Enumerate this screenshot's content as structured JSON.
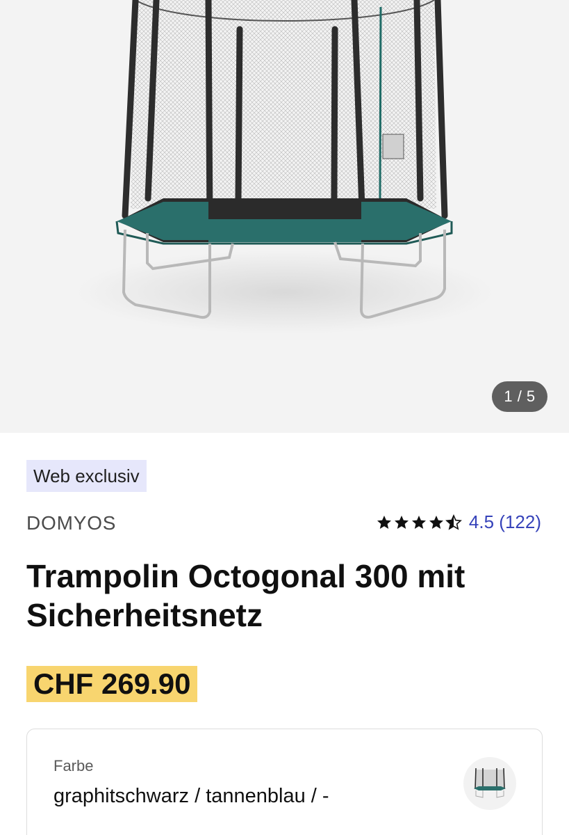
{
  "gallery": {
    "image_alt": "Trampolin Octogonal 300 mit Sicherheitsnetz",
    "counter": "1 / 5"
  },
  "product": {
    "badge": "Web exclusiv",
    "brand": "DOMYOS",
    "rating": {
      "stars_value": 4.5,
      "stars_max": 5,
      "text": "4.5 (122)"
    },
    "title": "Trampolin Octogonal 300 mit Sicherheitsnetz",
    "price": "CHF 269.90"
  },
  "variant": {
    "label": "Farbe",
    "value": "graphitschwarz / tannenblau / -"
  },
  "colors": {
    "badge_bg": "#e6e7fb",
    "price_bg": "#f8d56f",
    "rating_link": "#3643ba",
    "trampoline_frame": "#2a6f6b"
  }
}
